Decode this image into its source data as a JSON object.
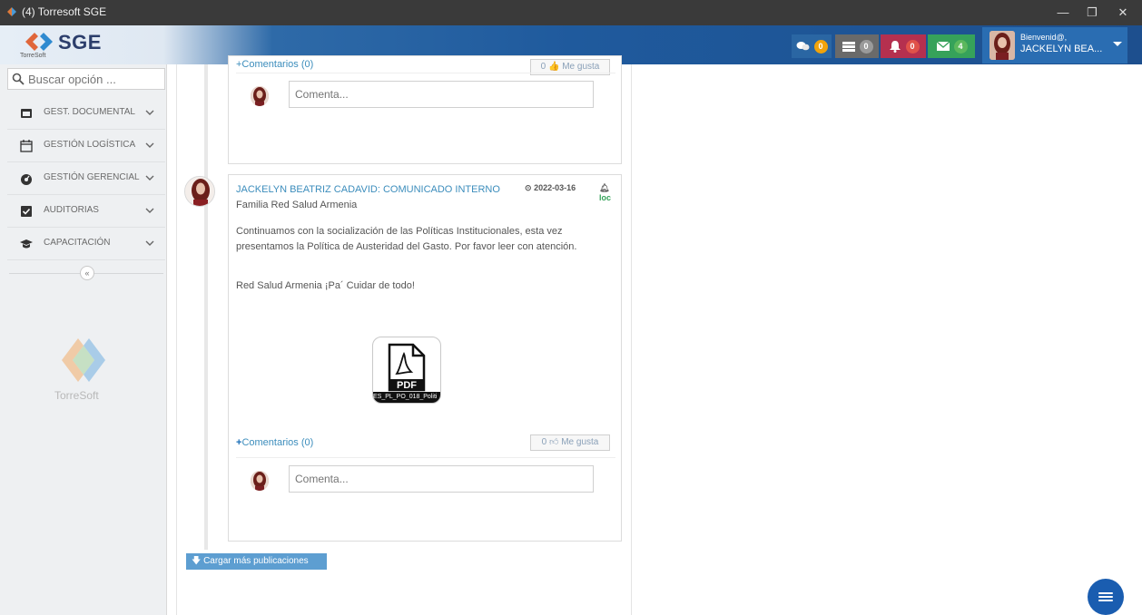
{
  "window": {
    "title": "(4) Torresoft SGE"
  },
  "brand": {
    "app": "SGE",
    "company": "TorreSoft",
    "sidebar_logo_text": "TorreSoft"
  },
  "topnav": {
    "chats": {
      "count": "0"
    },
    "tasks": {
      "count": "0"
    },
    "alerts": {
      "count": "0"
    },
    "messages": {
      "count": "4"
    },
    "user": {
      "greeting": "Bienvenid@,",
      "name": "JACKELYN BEA..."
    }
  },
  "sidebar": {
    "search_placeholder": "Buscar opción ...",
    "items": [
      {
        "label": "GEST. DOCUMENTAL",
        "icon": "document-icon"
      },
      {
        "label": "GESTIÓN LOGÍSTICA",
        "icon": "calendar-icon"
      },
      {
        "label": "GESTIÓN GERENCIAL",
        "icon": "gauge-icon"
      },
      {
        "label": "AUDITORIAS",
        "icon": "checkbox-icon"
      },
      {
        "label": "CAPACITACIÓN",
        "icon": "graduation-cap-icon"
      }
    ],
    "collapse_label": "«"
  },
  "feed": {
    "prev_post": {
      "comments_label": "+Comentarios (0)",
      "like_label": "0 👍 Me gusta",
      "comment_placeholder": "Comenta..."
    },
    "post": {
      "title": "JACKELYN BEATRIZ CADAVID: COMUNICADO INTERNO",
      "date": "2022-03-16",
      "loc": "loc",
      "group": "Familia  Red Salud Armenia",
      "body": "Continuamos con la socialización de las Políticas Institucionales, esta vez presentamos la Política de Austeridad del Gasto. Por favor leer con atención.",
      "signature": "Red Salud Armenia ¡Pa´ Cuidar de todo!",
      "attachment_name": "ES_PL_PO_018_Politi",
      "comments_label": "Comentarios (0)",
      "like_count": "0",
      "like_label": "Me gusta",
      "comment_placeholder": "Comenta..."
    },
    "load_more": "Cargar más publicaciones"
  },
  "colors": {
    "accent": "#3c8dbc",
    "nav_blue": "#1f5a9d",
    "badge_orange": "#f0a30a",
    "badge_gray": "#9a9a9a",
    "badge_red": "#e0524a",
    "badge_green": "#5cb85c"
  }
}
